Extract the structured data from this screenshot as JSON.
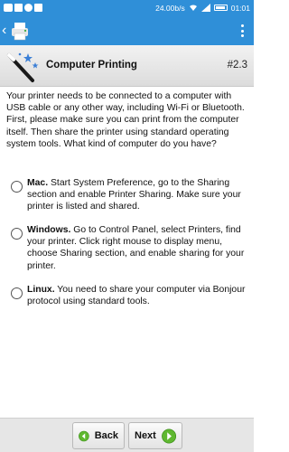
{
  "status_bar": {
    "network_speed": "24.00b/s",
    "time": "01:01"
  },
  "header": {
    "title": "Computer Printing",
    "step": "#2.3"
  },
  "content": {
    "intro": "Your printer needs to be connected to a computer with USB cable or any other way, including Wi-Fi or Bluetooth. First, please make sure you can print from the computer itself. Then share the printer using standard operating system tools. What kind of computer do you have?",
    "options": [
      {
        "title": "Mac.",
        "text": " Start System Preference, go to the Sharing section and enable Printer Sharing. Make sure your printer is listed and shared."
      },
      {
        "title": "Windows.",
        "text": " Go to Control Panel, select Printers, find your printer. Click right mouse to display menu, choose Sharing section, and enable sharing for your printer."
      },
      {
        "title": "Linux.",
        "text": " You need to share your computer via Bonjour protocol using standard tools."
      }
    ]
  },
  "nav": {
    "back_label": "Back",
    "next_label": "Next"
  },
  "colors": {
    "accent": "#2f8fd8",
    "button_arrow": "#5fb830"
  }
}
